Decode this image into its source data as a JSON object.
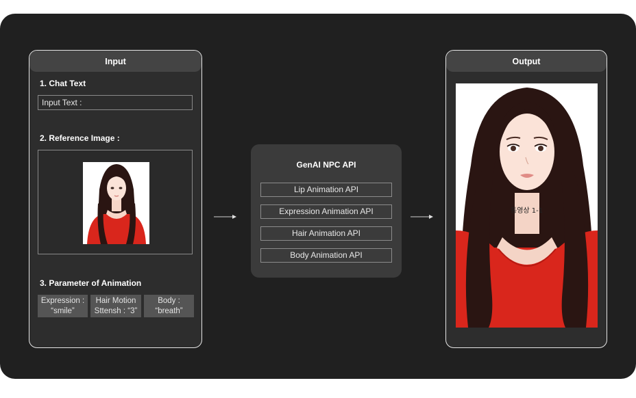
{
  "input": {
    "header": "Input",
    "chat_text_title": "1. Chat Text",
    "input_text_value": "Input Text :",
    "reference_image_title": "2. Reference Image :",
    "parameter_title": "3. Parameter of Animation",
    "parameters": [
      {
        "line1": "Expression :",
        "line2": "“smile”"
      },
      {
        "line1": "Hair Motion",
        "line2": "Sttensh : “3”"
      },
      {
        "line1": "Body :",
        "line2": "“breath”"
      }
    ]
  },
  "api": {
    "title": "GenAI NPC API",
    "items": [
      "Lip Animation API",
      "Expression Animation API",
      "Hair Animation API",
      "Body Animation API"
    ]
  },
  "output": {
    "header": "Output",
    "video_label": "동영상 1-1"
  },
  "colors": {
    "frame_bg": "#202020",
    "panel_bg": "#2d2d2d",
    "panel_border": "#e6e6e6",
    "header_bg": "#444444",
    "api_bg": "#3b3b3b",
    "param_bg": "#555555",
    "shirt_red": "#d9261c",
    "hair": "#2a1512"
  },
  "icons": {
    "flow_arrow": "arrow-right-icon",
    "portrait": "woman-portrait-illustration"
  }
}
